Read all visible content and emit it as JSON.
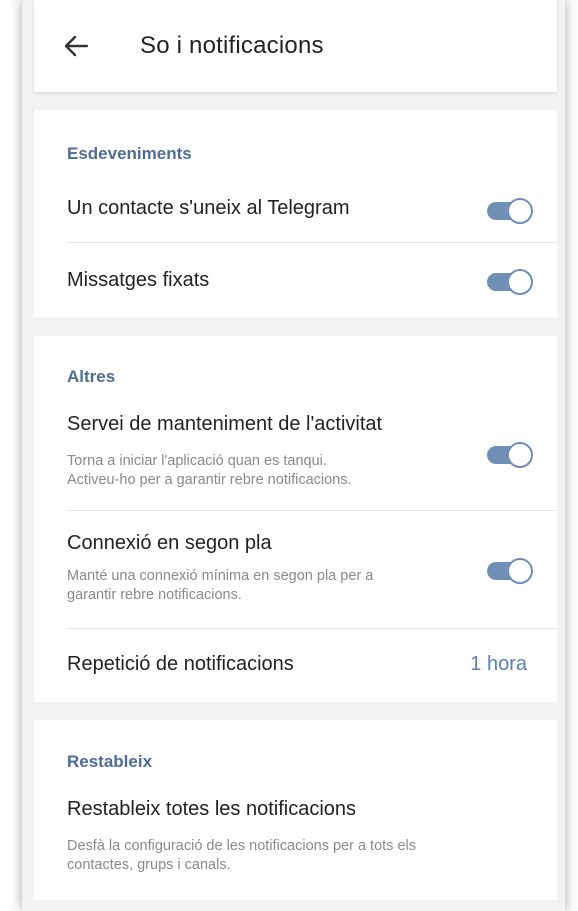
{
  "header": {
    "back_icon": "arrow-left-icon",
    "title": "So i notificacions"
  },
  "colors": {
    "accent": "#5b7fb0",
    "section_header": "#4d6c96",
    "toggle_on": "#6f8fb5",
    "background": "#f2f2f2"
  },
  "events": {
    "header": "Esdeveniments",
    "contact_joined": {
      "label": "Un contacte s'uneix al Telegram",
      "enabled": true
    },
    "pinned_messages": {
      "label": "Missatges fixats",
      "enabled": true
    }
  },
  "others": {
    "header": "Altres",
    "keep_alive": {
      "label": "Servei de manteniment de l'activitat",
      "description_line1": "Torna a iniciar l'aplicació quan es tanqui.",
      "description_line2": "Activeu-ho per a garantir rebre notificacions.",
      "enabled": true
    },
    "background_connection": {
      "label": "Connexió en segon pla",
      "description_line1": "Manté una connexió mínima en segon pla per a",
      "description_line2": "garantir rebre notificacions.",
      "enabled": true
    },
    "repeat_notifications": {
      "label": "Repetició de notificacions",
      "value": "1 hora"
    }
  },
  "reset": {
    "header": "Restableix",
    "reset_all": {
      "label": "Restableix totes les notificacions",
      "description_line1": "Desfà la configuració de les notificacions per a tots els",
      "description_line2": "contactes, grups i canals."
    }
  }
}
